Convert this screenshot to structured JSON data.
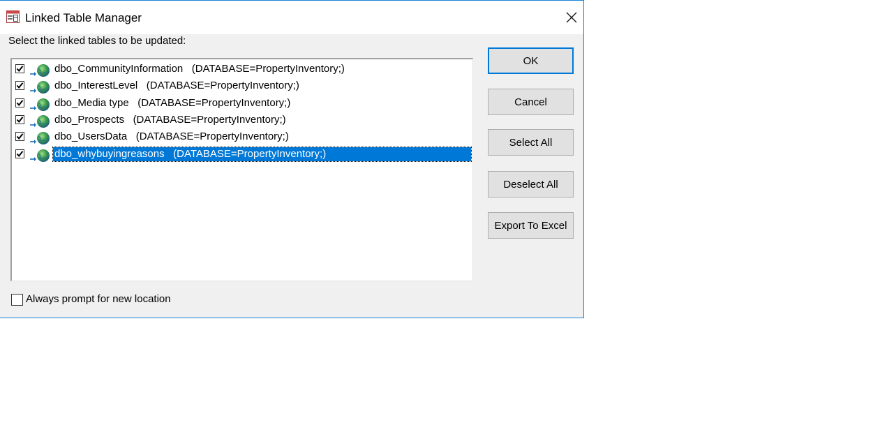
{
  "window": {
    "title": "Linked Table Manager",
    "close_glyph": "✕",
    "title_icon": "table-icon",
    "accent_color": "#0078d7"
  },
  "instructions": "Select the linked tables to be updated:",
  "tables": [
    {
      "label": "dbo_CommunityInformation   (DATABASE=PropertyInventory;)",
      "checked": true,
      "selected": false
    },
    {
      "label": "dbo_InterestLevel   (DATABASE=PropertyInventory;)",
      "checked": true,
      "selected": false
    },
    {
      "label": "dbo_Media type   (DATABASE=PropertyInventory;)",
      "checked": true,
      "selected": false
    },
    {
      "label": "dbo_Prospects   (DATABASE=PropertyInventory;)",
      "checked": true,
      "selected": false
    },
    {
      "label": "dbo_UsersData   (DATABASE=PropertyInventory;)",
      "checked": true,
      "selected": false
    },
    {
      "label": "dbo_whybuyingreasons   (DATABASE=PropertyInventory;)",
      "checked": true,
      "selected": true
    }
  ],
  "buttons": {
    "ok": "OK",
    "cancel": "Cancel",
    "select_all": "Select All",
    "deselect_all": "Deselect All",
    "export": "Export To Excel"
  },
  "always_prompt": {
    "label": "Always prompt for new location",
    "checked": false
  }
}
